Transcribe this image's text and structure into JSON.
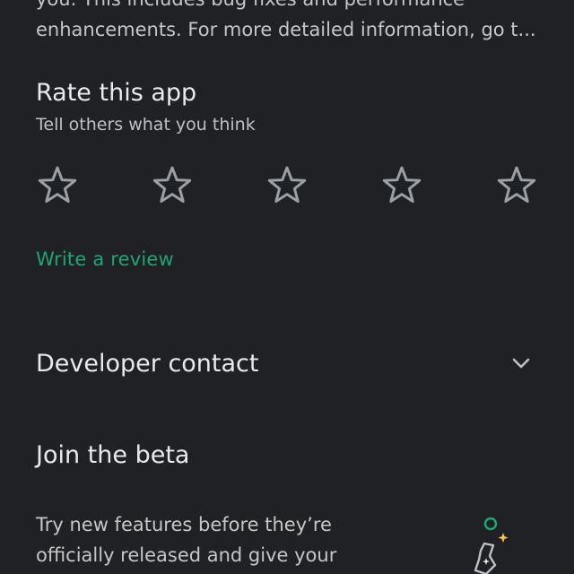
{
  "about": {
    "line1": "you. This includes bug fixes and performance",
    "line2": "enhancements. For more detailed information, go t..."
  },
  "rating": {
    "title": "Rate this app",
    "subtitle": "Tell others what you think",
    "max_stars": 5,
    "current_stars": 0,
    "write_review": "Write a review"
  },
  "developer_contact": {
    "title": "Developer contact"
  },
  "beta": {
    "title": "Join the beta",
    "description": "Try new features before they’re officially released and give your"
  },
  "colors": {
    "background": "#202124",
    "accent": "#1ea672",
    "star_outline": "#9aa0a6"
  },
  "icons": [
    "star-outline-icon",
    "chevron-down-icon",
    "beta-illustration-icon"
  ]
}
